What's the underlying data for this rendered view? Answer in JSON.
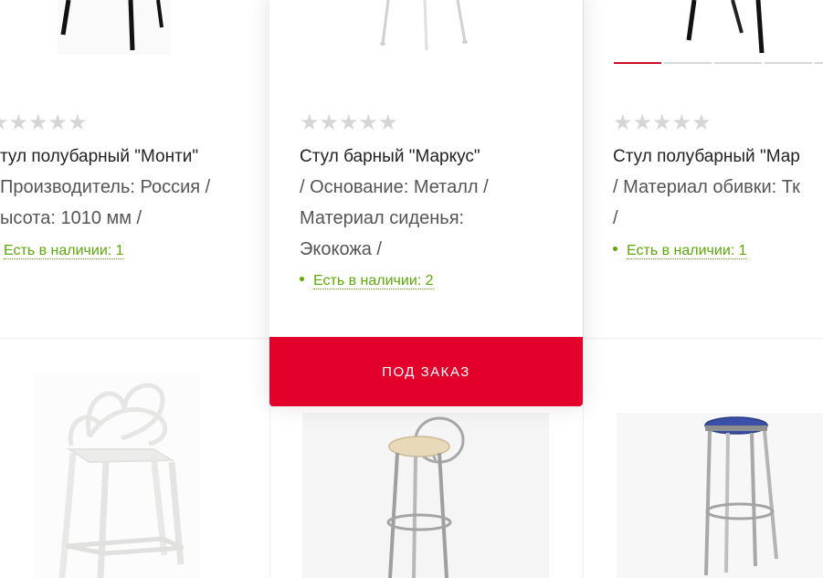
{
  "products_top": [
    {
      "stars": "★★★★★",
      "title": "тул полубарный \"Монти\"",
      "desc": "Производитель: Россия /",
      "desc2": "ысота: 1010 мм /",
      "stock": "Есть в наличии: 1"
    },
    {
      "stars": "★★★★★",
      "title": "Стул барный \"Маркус\"",
      "desc": "/ Основание: Металл /",
      "desc2": "Материал сиденья:",
      "desc3": "Экокожа /",
      "stock": "Есть в наличии: 2",
      "button": "ПОД ЗАКАЗ"
    },
    {
      "stars": "★★★★★",
      "title": "Стул полубарный \"Мар",
      "desc": "/ Материал обивки: Тк",
      "desc2": "/",
      "stock": "Есть в наличии: 1"
    }
  ],
  "colors": {
    "accent": "#e3002b",
    "stock_green": "#5da80a",
    "star_gray": "#d6d6d6",
    "seat_beige": "#e8d9b8",
    "seat_blue": "#3b4fa8"
  }
}
